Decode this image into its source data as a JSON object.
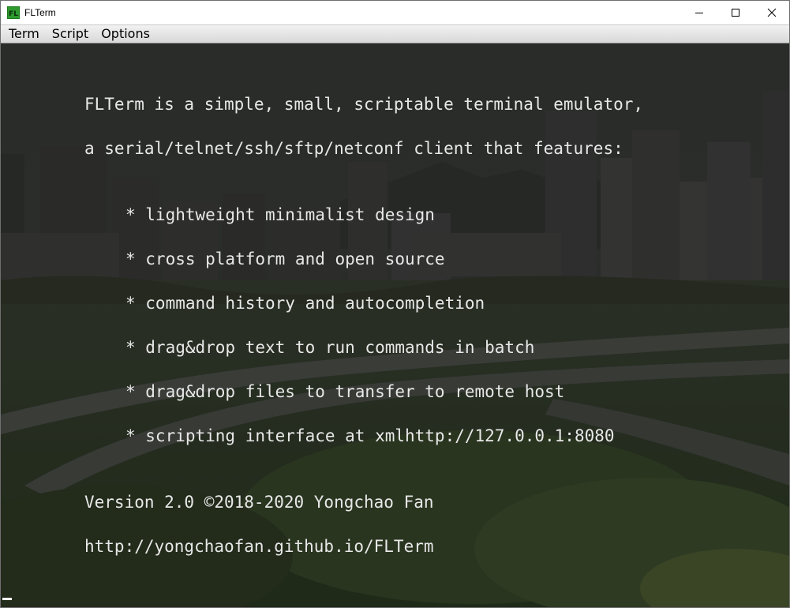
{
  "window": {
    "title": "FLTerm",
    "icon": "flterm-app-icon",
    "icon_text": "FL",
    "controls": [
      "minimize-icon",
      "maximize-icon",
      "close-icon"
    ]
  },
  "menu": {
    "items": [
      "Term",
      "Script",
      "Options"
    ]
  },
  "terminal": {
    "intro": [
      "FLTerm is a simple, small, scriptable terminal emulator,",
      "a serial/telnet/ssh/sftp/netconf client that features:"
    ],
    "features": [
      "* lightweight minimalist design",
      "* cross platform and open source",
      "* command history and autocompletion",
      "* drag&drop text to run commands in batch",
      "* drag&drop files to transfer to remote host",
      "* scripting interface at xmlhttp://127.0.0.1:8080"
    ],
    "version": "Version 2.0 ©2018-2020 Yongchao Fan",
    "url": "http://yongchaofan.github.io/FLTerm",
    "text_color": "#e8e8e8",
    "background": "dimmed city skyline photo"
  }
}
